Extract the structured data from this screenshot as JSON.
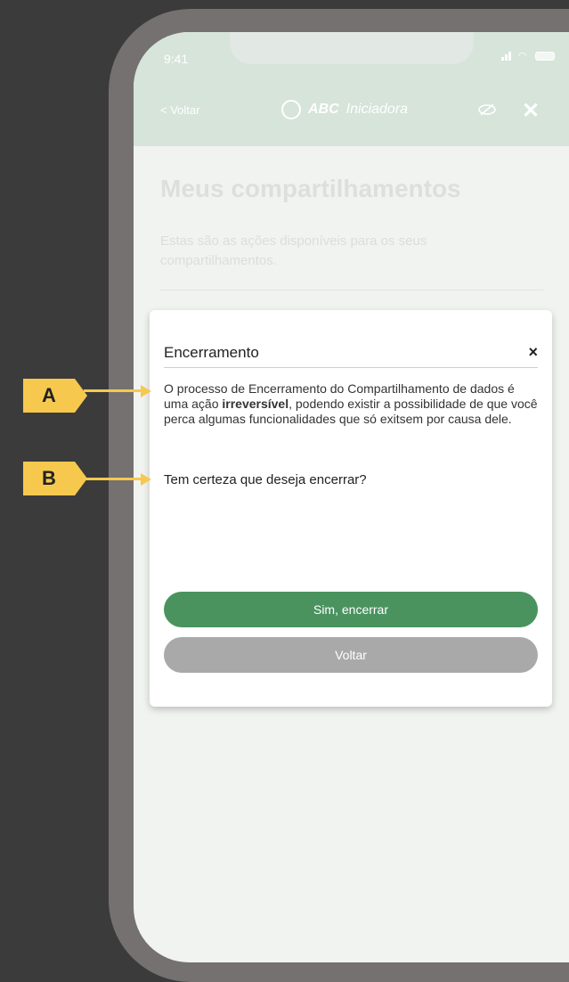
{
  "status_bar": {
    "time": "9:41"
  },
  "app_header": {
    "back_label": "< Voltar",
    "brand_abc": "ABC",
    "brand_suffix": "Iniciadora"
  },
  "page": {
    "title": "Meus compartilhamentos",
    "description": "Estas são as ações disponíveis para os seus compartilhamentos."
  },
  "modal": {
    "title": "Encerramento",
    "close_symbol": "×",
    "body_part1": "O processo de Encerramento do Compartilhamento de dados é uma ação ",
    "body_bold": "irreversível",
    "body_part2": ", podendo existir a possibilidade de que você perca algumas funcionalidades que só exitsem por causa dele.",
    "question": "Tem certeza que deseja encerrar?",
    "confirm_label": "Sim, encerrar",
    "back_label": "Voltar"
  },
  "annotations": [
    {
      "label": "A"
    },
    {
      "label": "B"
    }
  ],
  "colors": {
    "background": "#3b3b3b",
    "phone_frame": "#757170",
    "header_tint": "#d6e4da",
    "primary_button": "#4a935f",
    "secondary_button": "#a9a9a9",
    "marker": "#f6c94e"
  },
  "icons": [
    "signal-icon",
    "wifi-icon",
    "battery-icon",
    "brand-logo-icon",
    "eye-off-icon",
    "close-icon",
    "arrow-icon"
  ]
}
